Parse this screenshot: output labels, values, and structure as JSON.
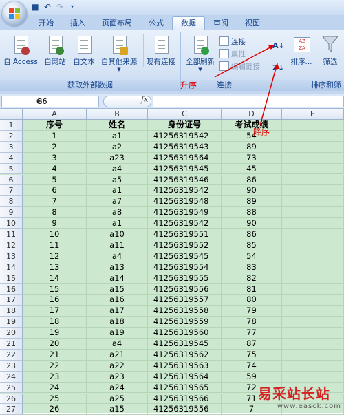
{
  "ribbon_tabs": [
    "开始",
    "插入",
    "页面布局",
    "公式",
    "数据",
    "审阅",
    "视图"
  ],
  "active_tab": "数据",
  "groups": {
    "external": {
      "label": "获取外部数据",
      "buttons": [
        "自 Access",
        "自网站",
        "自文本",
        "自其他来源",
        "现有连接"
      ]
    },
    "connections": {
      "label": "连接",
      "refresh": "全部刷新",
      "items": [
        "连接",
        "属性",
        "编辑链接"
      ]
    },
    "sort": {
      "label": "排序和筛",
      "sort_button": "排序...",
      "filter_button": "筛选"
    }
  },
  "name_box": "G6",
  "fx_label": "fx",
  "columns": [
    "A",
    "B",
    "C",
    "D",
    "E"
  ],
  "header_row": [
    "序号",
    "姓名",
    "身份证号",
    "考试成绩"
  ],
  "rows": [
    [
      "1",
      "a1",
      "41256319542",
      "54"
    ],
    [
      "2",
      "a2",
      "41256319543",
      "89"
    ],
    [
      "3",
      "a23",
      "41256319564",
      "73"
    ],
    [
      "4",
      "a4",
      "41256319545",
      "45"
    ],
    [
      "5",
      "a5",
      "41256319546",
      "86"
    ],
    [
      "6",
      "a1",
      "41256319542",
      "90"
    ],
    [
      "7",
      "a7",
      "41256319548",
      "89"
    ],
    [
      "8",
      "a8",
      "41256319549",
      "88"
    ],
    [
      "9",
      "a1",
      "41256319542",
      "90"
    ],
    [
      "10",
      "a10",
      "41256319551",
      "86"
    ],
    [
      "11",
      "a11",
      "41256319552",
      "85"
    ],
    [
      "12",
      "a4",
      "41256319545",
      "54"
    ],
    [
      "13",
      "a13",
      "41256319554",
      "83"
    ],
    [
      "14",
      "a14",
      "41256319555",
      "82"
    ],
    [
      "15",
      "a15",
      "41256319556",
      "81"
    ],
    [
      "16",
      "a16",
      "41256319557",
      "80"
    ],
    [
      "17",
      "a17",
      "41256319558",
      "79"
    ],
    [
      "18",
      "a18",
      "41256319559",
      "78"
    ],
    [
      "19",
      "a19",
      "41256319560",
      "77"
    ],
    [
      "20",
      "a4",
      "41256319545",
      "87"
    ],
    [
      "21",
      "a21",
      "41256319562",
      "75"
    ],
    [
      "22",
      "a22",
      "41256319563",
      "74"
    ],
    [
      "23",
      "a23",
      "41256319564",
      "59"
    ],
    [
      "24",
      "a24",
      "41256319565",
      "72"
    ],
    [
      "25",
      "a25",
      "41256319566",
      "71"
    ],
    [
      "26",
      "a15",
      "41256319556",
      "7"
    ]
  ],
  "annotations": {
    "ascending": "升序",
    "descending": "降序"
  },
  "watermark": {
    "title": "易采站长站",
    "url": "www.easck.com"
  },
  "colors": {
    "annotation": "#e00000",
    "grid_bg": "#cce8cf",
    "ribbon": "#d3e2f4"
  }
}
